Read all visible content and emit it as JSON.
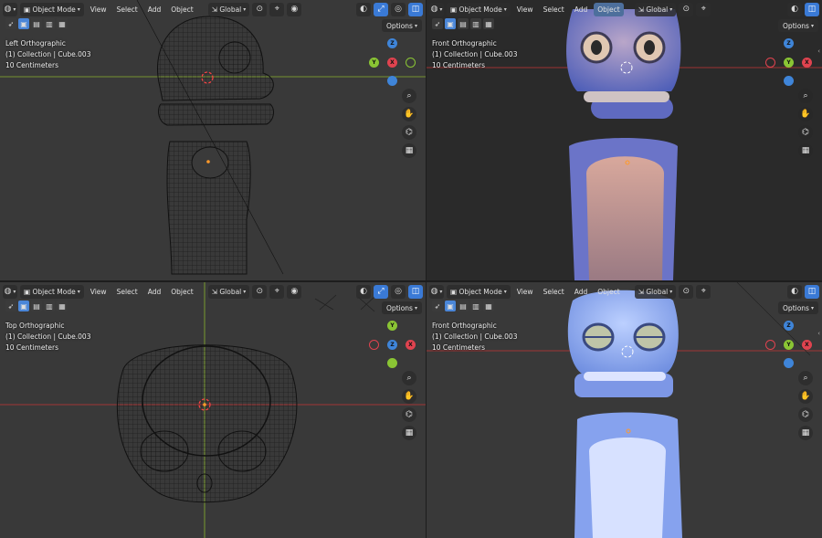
{
  "header": {
    "mode_label": "Object Mode",
    "menu": [
      "View",
      "Select",
      "Add",
      "Object"
    ],
    "transform_label": "Global"
  },
  "options_label": "Options",
  "viewports": {
    "tl": {
      "view_name": "Left Orthographic",
      "collection": "(1) Collection | Cube.003",
      "scale": "10 Centimeters",
      "gizmo": [
        "Z",
        "Y",
        "X"
      ]
    },
    "tr": {
      "view_name": "Front Orthographic",
      "collection": "(1) Collection | Cube.003",
      "scale": "10 Centimeters",
      "gizmo": [
        "Z",
        "X",
        "Y"
      ]
    },
    "bl": {
      "view_name": "Top Orthographic",
      "collection": "(1) Collection | Cube.003",
      "scale": "10 Centimeters",
      "gizmo": [
        "Y",
        "X",
        "Z"
      ]
    },
    "br": {
      "view_name": "Front Orthographic",
      "collection": "(1) Collection | Cube.003",
      "scale": "10 Centimeters",
      "gizmo": [
        "Z",
        "X",
        "Y"
      ]
    }
  },
  "icons": {
    "editor_type": "globe-icon",
    "zoom": "magnify-icon",
    "pan": "hand-icon",
    "camera": "camera-icon",
    "grid": "grid-icon"
  },
  "colors": {
    "axis_x": "#e0434f",
    "axis_y": "#8ac534",
    "axis_z": "#3f85d9",
    "accent": "#3a7ad6"
  }
}
